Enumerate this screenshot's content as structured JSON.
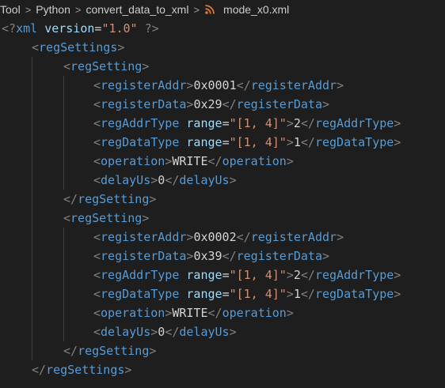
{
  "breadcrumb": {
    "items": [
      "Tool",
      "Python",
      "convert_data_to_xml",
      "mode_x0.xml"
    ],
    "separator": ">",
    "file_icon": "rss-icon"
  },
  "editor": {
    "lines": [
      {
        "segments": [
          {
            "c": "punc",
            "t": "<?"
          },
          {
            "c": "tag",
            "t": "xml"
          },
          {
            "c": "text",
            "t": " "
          },
          {
            "c": "attr",
            "t": "version"
          },
          {
            "c": "text",
            "t": "="
          },
          {
            "c": "str",
            "t": "\"1.0\""
          },
          {
            "c": "text",
            "t": " "
          },
          {
            "c": "punc",
            "t": "?>"
          }
        ]
      },
      {
        "segments": [
          {
            "c": "punc",
            "t": "<"
          },
          {
            "c": "tag",
            "t": "regSettings"
          },
          {
            "c": "punc",
            "t": ">"
          }
        ]
      },
      {
        "segments": [
          {
            "c": "punc",
            "t": "<"
          },
          {
            "c": "tag",
            "t": "regSetting"
          },
          {
            "c": "punc",
            "t": ">"
          }
        ]
      },
      {
        "segments": [
          {
            "c": "punc",
            "t": "<"
          },
          {
            "c": "tag",
            "t": "registerAddr"
          },
          {
            "c": "punc",
            "t": ">"
          },
          {
            "c": "text",
            "t": "0x0001"
          },
          {
            "c": "punc",
            "t": "</"
          },
          {
            "c": "tag",
            "t": "registerAddr"
          },
          {
            "c": "punc",
            "t": ">"
          }
        ]
      },
      {
        "segments": [
          {
            "c": "punc",
            "t": "<"
          },
          {
            "c": "tag",
            "t": "registerData"
          },
          {
            "c": "punc",
            "t": ">"
          },
          {
            "c": "text",
            "t": "0x29"
          },
          {
            "c": "punc",
            "t": "</"
          },
          {
            "c": "tag",
            "t": "registerData"
          },
          {
            "c": "punc",
            "t": ">"
          }
        ]
      },
      {
        "segments": [
          {
            "c": "punc",
            "t": "<"
          },
          {
            "c": "tag",
            "t": "regAddrType"
          },
          {
            "c": "text",
            "t": " "
          },
          {
            "c": "attr",
            "t": "range"
          },
          {
            "c": "text",
            "t": "="
          },
          {
            "c": "str",
            "t": "\"[1, 4]\""
          },
          {
            "c": "punc",
            "t": ">"
          },
          {
            "c": "text",
            "t": "2"
          },
          {
            "c": "punc",
            "t": "</"
          },
          {
            "c": "tag",
            "t": "regAddrType"
          },
          {
            "c": "punc",
            "t": ">"
          }
        ]
      },
      {
        "segments": [
          {
            "c": "punc",
            "t": "<"
          },
          {
            "c": "tag",
            "t": "regDataType"
          },
          {
            "c": "text",
            "t": " "
          },
          {
            "c": "attr",
            "t": "range"
          },
          {
            "c": "text",
            "t": "="
          },
          {
            "c": "str",
            "t": "\"[1, 4]\""
          },
          {
            "c": "punc",
            "t": ">"
          },
          {
            "c": "text",
            "t": "1"
          },
          {
            "c": "punc",
            "t": "</"
          },
          {
            "c": "tag",
            "t": "regDataType"
          },
          {
            "c": "punc",
            "t": ">"
          }
        ]
      },
      {
        "segments": [
          {
            "c": "punc",
            "t": "<"
          },
          {
            "c": "tag",
            "t": "operation"
          },
          {
            "c": "punc",
            "t": ">"
          },
          {
            "c": "text",
            "t": "WRITE"
          },
          {
            "c": "punc",
            "t": "</"
          },
          {
            "c": "tag",
            "t": "operation"
          },
          {
            "c": "punc",
            "t": ">"
          }
        ]
      },
      {
        "segments": [
          {
            "c": "punc",
            "t": "<"
          },
          {
            "c": "tag",
            "t": "delayUs"
          },
          {
            "c": "punc",
            "t": ">"
          },
          {
            "c": "text",
            "t": "0"
          },
          {
            "c": "punc",
            "t": "</"
          },
          {
            "c": "tag",
            "t": "delayUs"
          },
          {
            "c": "punc",
            "t": ">"
          }
        ]
      },
      {
        "segments": [
          {
            "c": "punc",
            "t": "</"
          },
          {
            "c": "tag",
            "t": "regSetting"
          },
          {
            "c": "punc",
            "t": ">"
          }
        ]
      },
      {
        "segments": [
          {
            "c": "punc",
            "t": "<"
          },
          {
            "c": "tag",
            "t": "regSetting"
          },
          {
            "c": "punc",
            "t": ">"
          }
        ]
      },
      {
        "segments": [
          {
            "c": "punc",
            "t": "<"
          },
          {
            "c": "tag",
            "t": "registerAddr"
          },
          {
            "c": "punc",
            "t": ">"
          },
          {
            "c": "text",
            "t": "0x0002"
          },
          {
            "c": "punc",
            "t": "</"
          },
          {
            "c": "tag",
            "t": "registerAddr"
          },
          {
            "c": "punc",
            "t": ">"
          }
        ]
      },
      {
        "segments": [
          {
            "c": "punc",
            "t": "<"
          },
          {
            "c": "tag",
            "t": "registerData"
          },
          {
            "c": "punc",
            "t": ">"
          },
          {
            "c": "text",
            "t": "0x39"
          },
          {
            "c": "punc",
            "t": "</"
          },
          {
            "c": "tag",
            "t": "registerData"
          },
          {
            "c": "punc",
            "t": ">"
          }
        ]
      },
      {
        "segments": [
          {
            "c": "punc",
            "t": "<"
          },
          {
            "c": "tag",
            "t": "regAddrType"
          },
          {
            "c": "text",
            "t": " "
          },
          {
            "c": "attr",
            "t": "range"
          },
          {
            "c": "text",
            "t": "="
          },
          {
            "c": "str",
            "t": "\"[1, 4]\""
          },
          {
            "c": "punc",
            "t": ">"
          },
          {
            "c": "text",
            "t": "2"
          },
          {
            "c": "punc",
            "t": "</"
          },
          {
            "c": "tag",
            "t": "regAddrType"
          },
          {
            "c": "punc",
            "t": ">"
          }
        ]
      },
      {
        "segments": [
          {
            "c": "punc",
            "t": "<"
          },
          {
            "c": "tag",
            "t": "regDataType"
          },
          {
            "c": "text",
            "t": " "
          },
          {
            "c": "attr",
            "t": "range"
          },
          {
            "c": "text",
            "t": "="
          },
          {
            "c": "str",
            "t": "\"[1, 4]\""
          },
          {
            "c": "punc",
            "t": ">"
          },
          {
            "c": "text",
            "t": "1"
          },
          {
            "c": "punc",
            "t": "</"
          },
          {
            "c": "tag",
            "t": "regDataType"
          },
          {
            "c": "punc",
            "t": ">"
          }
        ]
      },
      {
        "segments": [
          {
            "c": "punc",
            "t": "<"
          },
          {
            "c": "tag",
            "t": "operation"
          },
          {
            "c": "punc",
            "t": ">"
          },
          {
            "c": "text",
            "t": "WRITE"
          },
          {
            "c": "punc",
            "t": "</"
          },
          {
            "c": "tag",
            "t": "operation"
          },
          {
            "c": "punc",
            "t": ">"
          }
        ]
      },
      {
        "segments": [
          {
            "c": "punc",
            "t": "<"
          },
          {
            "c": "tag",
            "t": "delayUs"
          },
          {
            "c": "punc",
            "t": ">"
          },
          {
            "c": "text",
            "t": "0"
          },
          {
            "c": "punc",
            "t": "</"
          },
          {
            "c": "tag",
            "t": "delayUs"
          },
          {
            "c": "punc",
            "t": ">"
          }
        ]
      },
      {
        "segments": [
          {
            "c": "punc",
            "t": "</"
          },
          {
            "c": "tag",
            "t": "regSetting"
          },
          {
            "c": "punc",
            "t": ">"
          }
        ]
      },
      {
        "segments": [
          {
            "c": "punc",
            "t": "</"
          },
          {
            "c": "tag",
            "t": "regSettings"
          },
          {
            "c": "punc",
            "t": ">"
          }
        ]
      }
    ]
  },
  "colors": {
    "background": "#1e1e1e",
    "tag": "#569cd6",
    "attribute": "#9cdcfe",
    "string": "#ce9178",
    "punctuation": "#808080",
    "text": "#d4d4d4",
    "file_icon": "#e37933"
  }
}
